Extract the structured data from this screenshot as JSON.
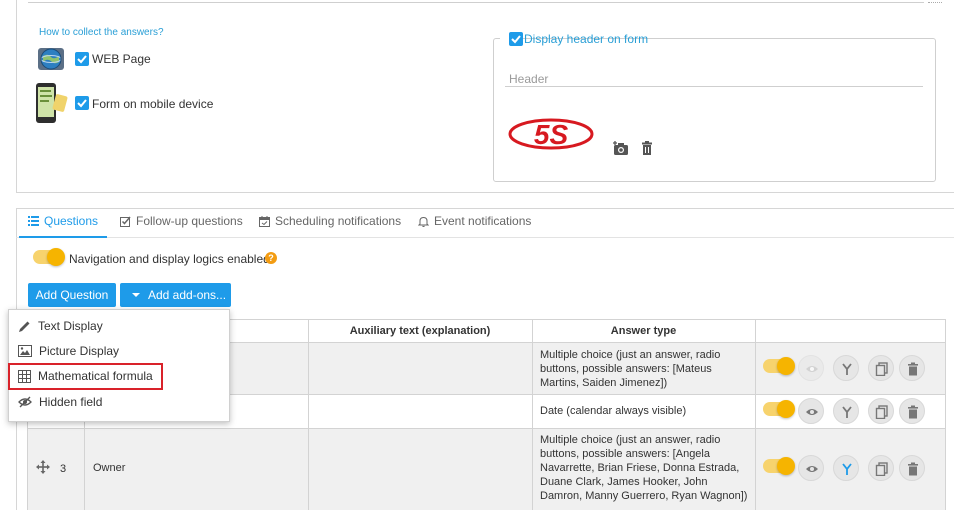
{
  "collect": {
    "label": "How to collect the answers?",
    "web_label": "WEB Page",
    "mobile_label": "Form on mobile device"
  },
  "header_box": {
    "legend": "Display header on form",
    "placeholder": "Header",
    "logo_text": "5S"
  },
  "tabs": [
    {
      "label": "Questions",
      "icon": "list-icon",
      "active": true
    },
    {
      "label": "Follow-up questions",
      "icon": "check-square-icon"
    },
    {
      "label": "Scheduling notifications",
      "icon": "calendar-icon"
    },
    {
      "label": "Event notifications",
      "icon": "bell-icon"
    }
  ],
  "navigation": {
    "label": "Navigation and display logics enabled",
    "help": "?"
  },
  "buttons": {
    "add_question": "Add Question",
    "add_addons": "Add add-ons..."
  },
  "dropdown": {
    "items": [
      {
        "label": "Text Display",
        "icon": "pencil-icon"
      },
      {
        "label": "Picture Display",
        "icon": "picture-icon"
      },
      {
        "label": "Mathematical formula",
        "icon": "calculator-grid-icon"
      },
      {
        "label": "Hidden field",
        "icon": "eye-slash-icon"
      }
    ]
  },
  "table": {
    "headers": [
      "Auxiliary text (explanation)",
      "Answer type"
    ],
    "rows": [
      {
        "number": "",
        "question": "",
        "aux": "",
        "answer_type_lines": [
          "Multiple choice (just an answer, radio",
          "buttons, possible answers: [Mateus",
          "Martins, Saiden Jimenez])"
        ]
      },
      {
        "number": "",
        "question": "",
        "aux": "",
        "answer_type_lines": [
          "Date (calendar always visible)"
        ]
      },
      {
        "number": "3",
        "question": "Owner",
        "aux": "",
        "answer_type_lines": [
          "Multiple choice (just an answer, radio",
          "buttons, possible answers: [Angela",
          "Navarrette, Brian Friese, Donna Estrada,",
          "Duane Clark, James Hooker, John",
          "Damron, Manny Guerrero, Ryan Wagnon])"
        ]
      }
    ]
  },
  "colors": {
    "accent": "#1e9be9",
    "toggle": "#f6b400",
    "highlight": "#d9222a",
    "row_bg": "#f0f0f0"
  }
}
